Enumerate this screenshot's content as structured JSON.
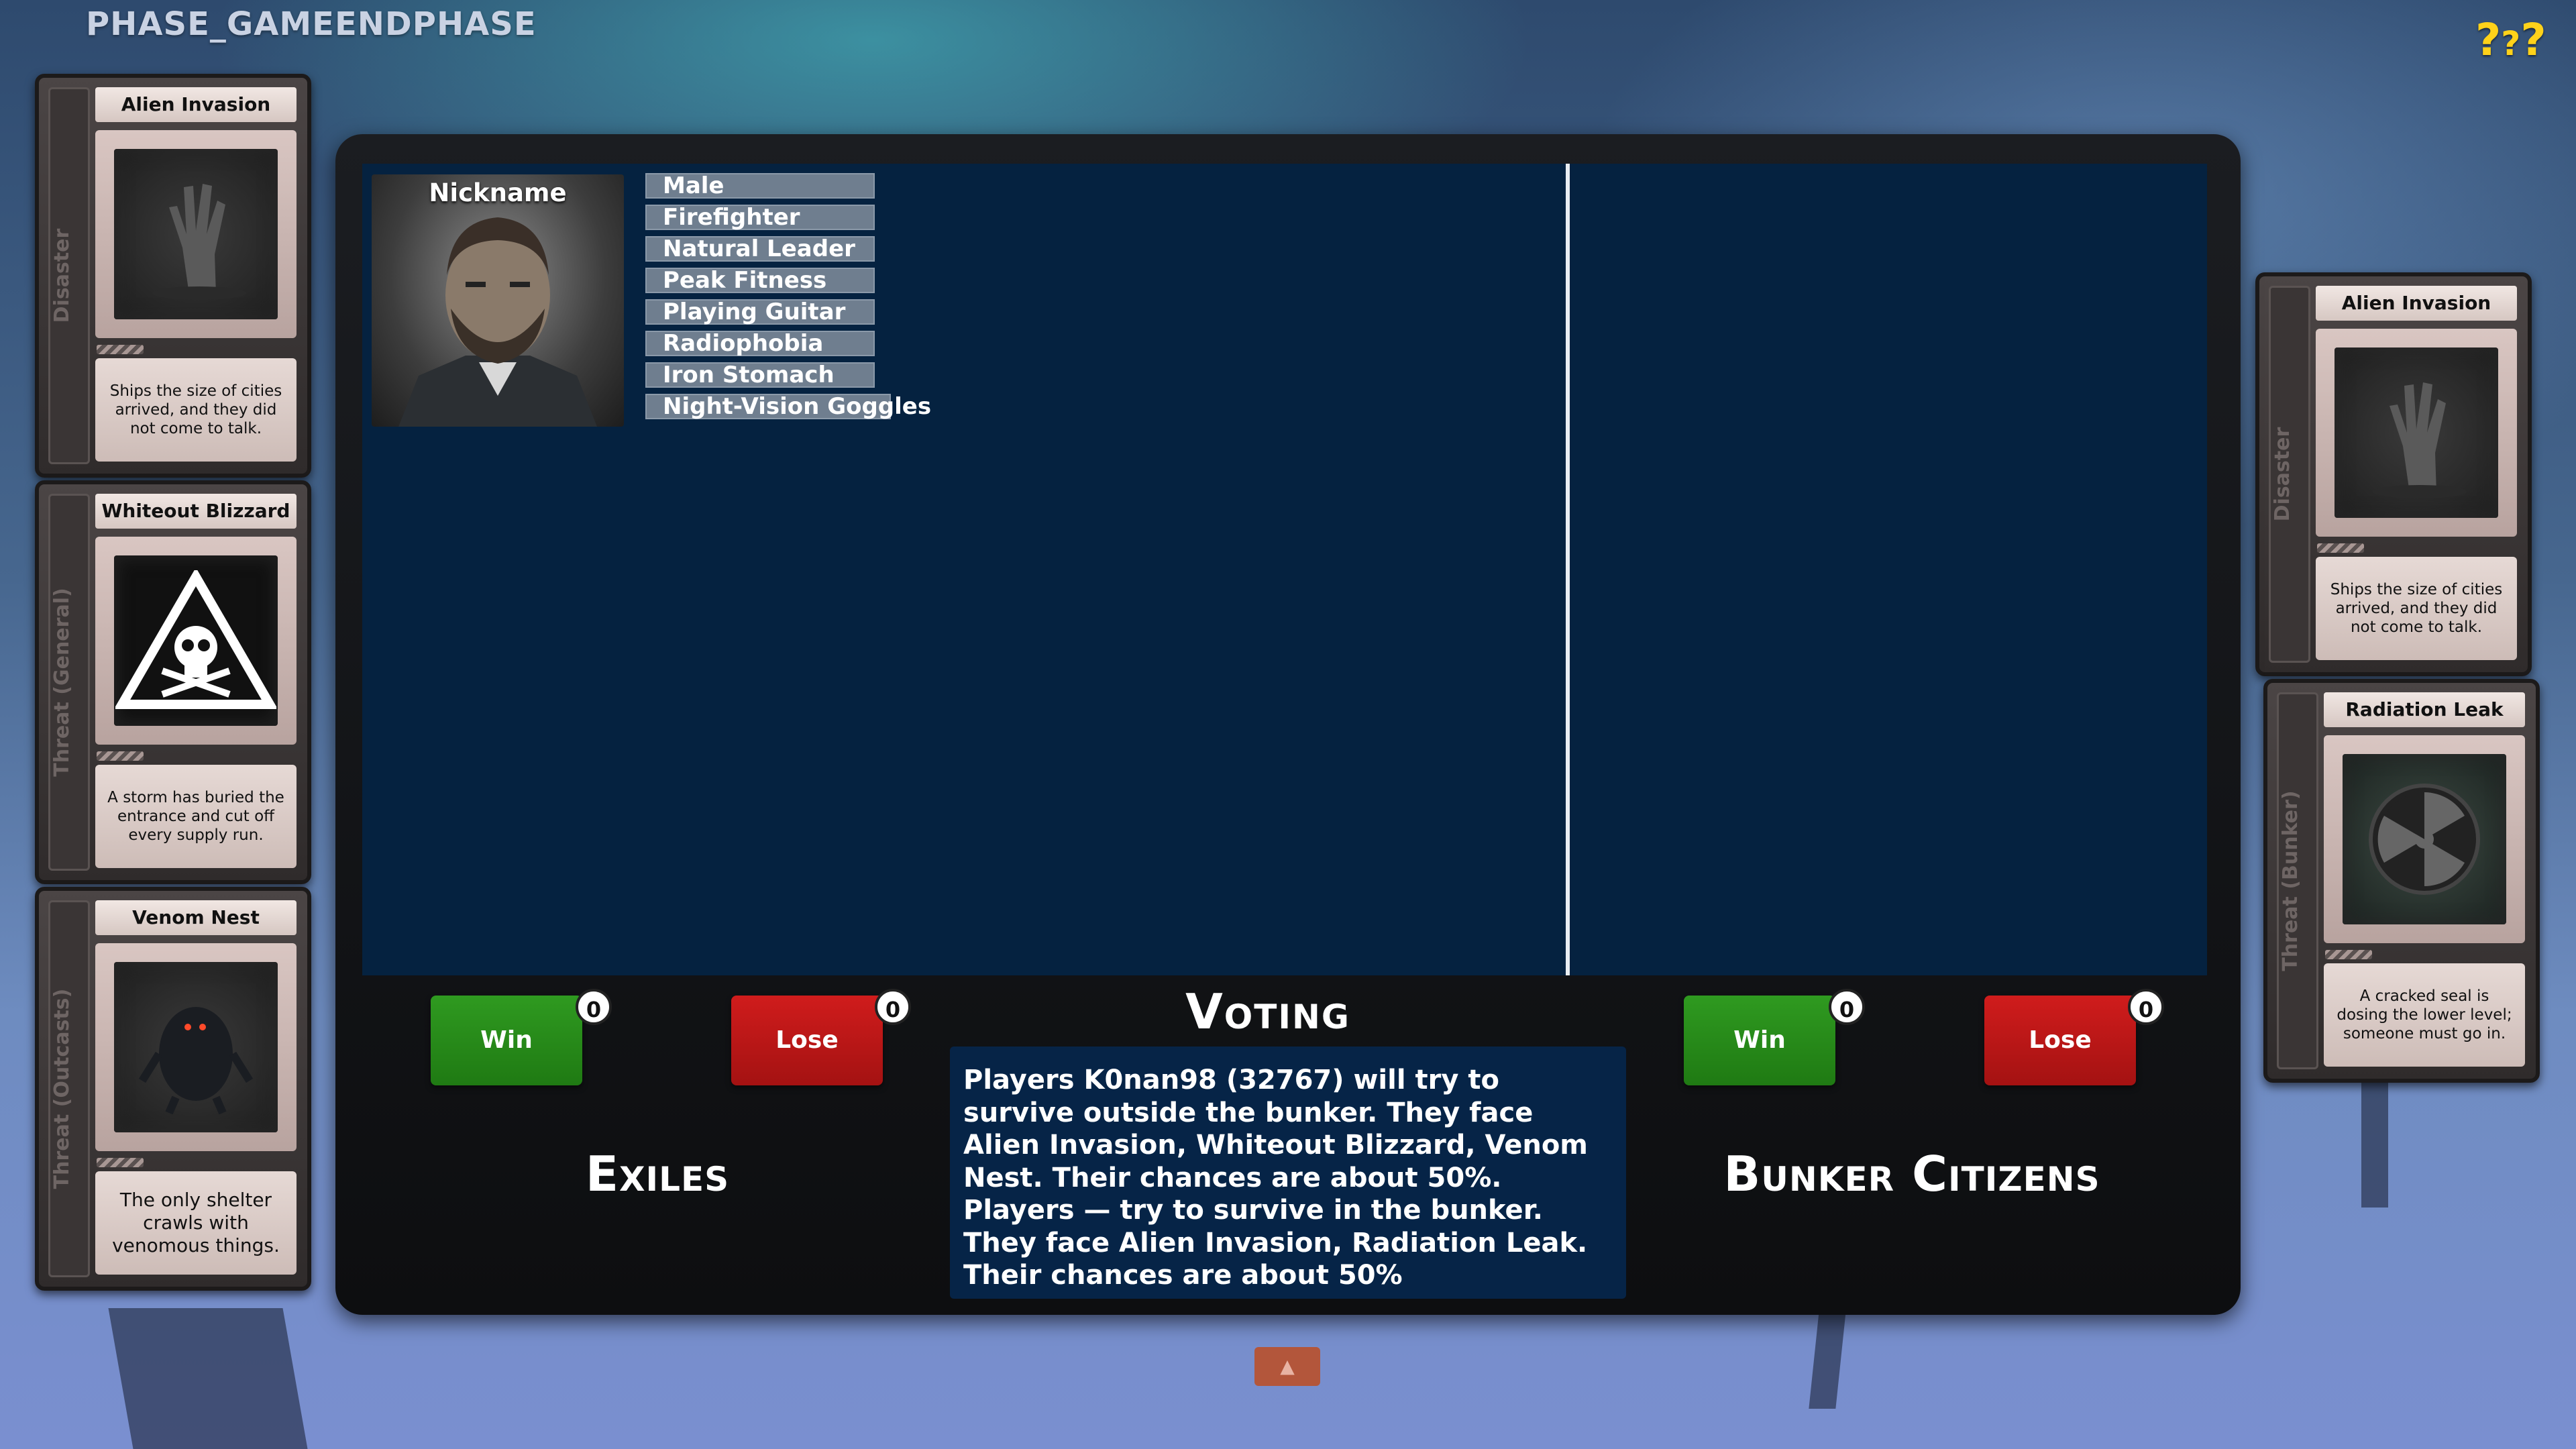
{
  "phase": "PHASE_GAMEENDPHASE",
  "help_label": "?",
  "left_cards": [
    {
      "title": "Alien Invasion",
      "type": "Disaster",
      "text": "Ships the size of cities arrived, and they did not come to talk.",
      "icon": "zombie-hand-icon"
    },
    {
      "title": "Whiteout Blizzard",
      "type": "Threat (General)",
      "text": "A storm has buried the entrance and cut off every supply run.",
      "icon": "skull-warning-icon"
    },
    {
      "title": "Venom Nest",
      "type": "Threat (Outcasts)",
      "text": "The only shelter crawls with venomous things.",
      "icon": "monster-icon"
    }
  ],
  "right_cards": [
    {
      "title": "Alien Invasion",
      "type": "Disaster",
      "text": "Ships the size of cities arrived, and they did not come to talk.",
      "icon": "zombie-hand-icon"
    },
    {
      "title": "Radiation Leak",
      "type": "Threat (Bunker)",
      "text": "A cracked seal is dosing the lower level; someone must go in.",
      "icon": "radiation-icon"
    }
  ],
  "player": {
    "nickname": "Nickname",
    "traits": [
      "Male",
      "Firefighter",
      "Natural Leader",
      "Peak Fitness",
      "Playing Guitar",
      "Radiophobia",
      "Iron Stomach",
      "Night-Vision Goggles"
    ]
  },
  "voting": {
    "title": "Voting",
    "text_line1": "Players K0nan98 (32767) will try to survive outside the bunker. They face Alien Invasion, Whiteout Blizzard, Venom Nest. Their chances are about 50%.",
    "text_line2": "Players — try to survive in the bunker. They face Alien Invasion, Radiation Leak. Their chances are about 50%"
  },
  "exiles": {
    "label": "Exiles",
    "win_label": "Win",
    "lose_label": "Lose",
    "win_count": "0",
    "lose_count": "0"
  },
  "bunker": {
    "label": "Bunker Citizens",
    "win_label": "Win",
    "lose_label": "Lose",
    "win_count": "0",
    "lose_count": "0"
  },
  "toggle_label": "▲",
  "colors": {
    "board": "#052240",
    "win": "#1f7a13",
    "lose": "#a41212",
    "help": "#ffd21a"
  }
}
